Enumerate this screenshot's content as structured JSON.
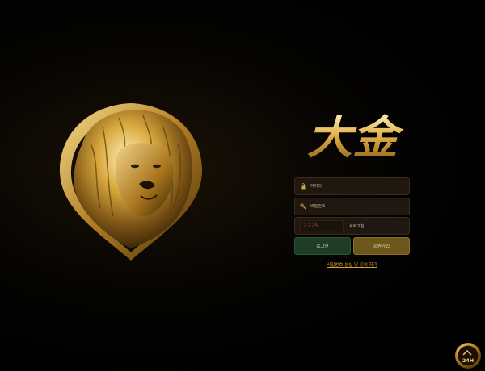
{
  "logo": {
    "text": "大金"
  },
  "form": {
    "id_placeholder": "아이디",
    "password_placeholder": "비밀번호",
    "captcha_code": "2779",
    "captcha_refresh": "새로고침",
    "login_label": "로그인",
    "join_label": "회원가입",
    "find_link": "비밀번호 분실 및 문의 하기"
  },
  "badge": {
    "text": "24H"
  },
  "colors": {
    "gold": "#d4a53a",
    "login_bg": "#1f3d26",
    "join_bg": "#6d5619",
    "field_bg": "#201810"
  }
}
